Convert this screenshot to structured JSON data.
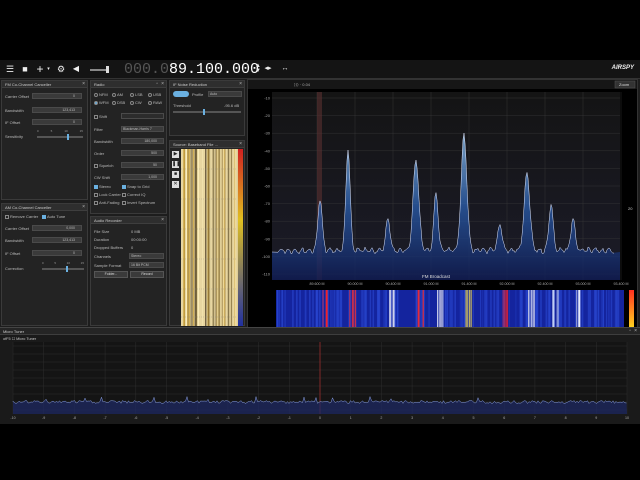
{
  "toolbar": {
    "icons": [
      "menu-icon",
      "stop-icon",
      "add-icon",
      "settings-icon",
      "volume-icon"
    ],
    "frequency_dim": "000.0",
    "frequency": "89.100.000",
    "brand": "AIRSPY"
  },
  "fm_canceller": {
    "title": "FM Co-Channel Canceller",
    "carrier_offset_label": "Carrier Offset",
    "carrier_offset": "0",
    "bandwidth_label": "Bandwidth",
    "bandwidth": "123,413",
    "if_offset_label": "IF Offset",
    "if_offset": "0",
    "sensitivity_label": "Sensitivity",
    "ticks": [
      "0",
      "5",
      "10",
      "15"
    ]
  },
  "am_canceller": {
    "title": "AM Co-Channel Canceller",
    "remove_carrier": "Remove Carrier",
    "auto_tune": "Auto Tune",
    "carrier_offset_label": "Carrier Offset",
    "carrier_offset": "0,000",
    "bandwidth_label": "Bandwidth",
    "bandwidth": "123,413",
    "if_offset_label": "IF Offset",
    "if_offset": "0",
    "correction_label": "Correction",
    "ticks": [
      "0",
      "5",
      "10",
      "15"
    ]
  },
  "radio": {
    "title": "Radio",
    "modes": [
      "NFM",
      "AM",
      "LSB",
      "USB",
      "WFM",
      "DSB",
      "CW",
      "RAW"
    ],
    "shift_label": "Shift",
    "filter_label": "Filter",
    "filter_value": "Blackman-Harris 7",
    "bandwidth_label": "Bandwidth",
    "bandwidth_value": "180,000",
    "order_label": "Order",
    "order_value": "500",
    "squelch_label": "Squelch",
    "squelch_value": "50",
    "cw_shift_label": "CW Shift",
    "cw_shift_value": "1,000",
    "options": [
      "Stereo",
      "Snap to Grid",
      "Lock Carrier",
      "Correct IQ",
      "Anti-Fading",
      "Invert Spectrum"
    ]
  },
  "recorder": {
    "title": "Audio Recorder",
    "file_size_label": "File Size",
    "file_size": "0 MB",
    "duration_label": "Duration",
    "duration": "00:00:00",
    "dropped_label": "Dropped Buffers",
    "dropped": "0",
    "channels_label": "Channels",
    "channels": "Stereo",
    "format_label": "Sample Format",
    "format": "16 Bit PCM",
    "record_label": "Record",
    "folder_label": "Folder..."
  },
  "iff_noise": {
    "title": "IF Noise Reduction",
    "profile_label": "Profile",
    "profile_value": "Auto",
    "threshold_label": "Threshold",
    "threshold_value": "-95.6 dB"
  },
  "baseband": {
    "title": "Source: Baseband File ...",
    "controls": [
      "play-icon",
      "pause-icon",
      "stop-icon",
      "close-icon"
    ]
  },
  "spectrum": {
    "y_labels": [
      "-10",
      "-20",
      "-30",
      "-40",
      "-50",
      "-60",
      "-70",
      "-80",
      "-90",
      "-100",
      "-110"
    ],
    "x_labels": [
      "89.600 M",
      "90.000 M",
      "90.400 M",
      "91.000 M",
      "91.400 M",
      "92.000 M",
      "92.400 M",
      "93.000 M",
      "93.400 M"
    ],
    "station_label": "FM Broadcast",
    "zoom_label": "Zoom",
    "right_value": "20",
    "top_value": "0.04"
  },
  "micro_tuner": {
    "title": "Micro Tuner",
    "label": "Micro Tuner",
    "x_labels": [
      "-10",
      "-9",
      "-8",
      "-7",
      "-6",
      "-5",
      "-4",
      "-3",
      "-2",
      "-1",
      "0",
      "1",
      "2",
      "3",
      "4",
      "5",
      "6",
      "7",
      "8",
      "9",
      "10"
    ]
  },
  "colors": {
    "accent": "#6ab0e0",
    "peak": "#3a7fd0",
    "waterfall_bg": "#14249e"
  }
}
